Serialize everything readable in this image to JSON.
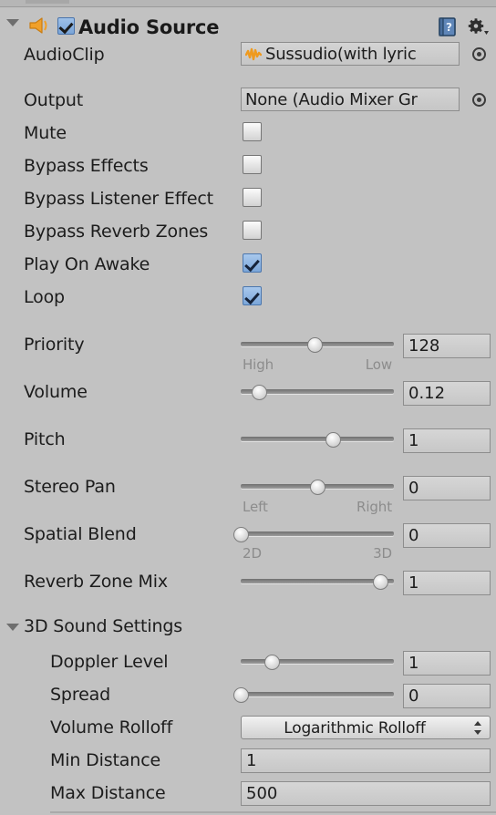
{
  "component": {
    "title": "Audio Source",
    "enabled_checkbox": true,
    "expanded": true,
    "icon": "speaker-icon",
    "help_icon": "help-book-icon",
    "menu_icon": "gear-icon"
  },
  "object_fields": [
    {
      "label": "AudioClip",
      "value": "Sussudio(with lyric",
      "icon": "audio-clip-icon",
      "has_picker": true
    },
    {
      "label": "Output",
      "value": "None (Audio Mixer Gr",
      "has_picker": true
    }
  ],
  "toggles": [
    {
      "label": "Mute",
      "checked": false
    },
    {
      "label": "Bypass Effects",
      "checked": false
    },
    {
      "label": "Bypass Listener Effect",
      "checked": false
    },
    {
      "label": "Bypass Reverb Zones",
      "checked": false
    },
    {
      "label": "Play On Awake",
      "checked": true
    },
    {
      "label": "Loop",
      "checked": true
    }
  ],
  "sliders": [
    {
      "label": "Priority",
      "value": "128",
      "fraction": 0.48,
      "min_label": "High",
      "max_label": "Low"
    },
    {
      "label": "Volume",
      "value": "0.12",
      "fraction": 0.12,
      "min_label": "",
      "max_label": ""
    },
    {
      "label": "Pitch",
      "value": "1",
      "fraction": 0.6,
      "min_label": "",
      "max_label": ""
    },
    {
      "label": "Stereo Pan",
      "value": "0",
      "fraction": 0.5,
      "min_label": "Left",
      "max_label": "Right"
    },
    {
      "label": "Spatial Blend",
      "value": "0",
      "fraction": 0.0,
      "min_label": "2D",
      "max_label": "3D"
    },
    {
      "label": "Reverb Zone Mix",
      "value": "1",
      "fraction": 0.91,
      "min_label": "",
      "max_label": ""
    }
  ],
  "sound_3d": {
    "section_title": "3D Sound Settings",
    "expanded": true,
    "sliders": [
      {
        "label": "Doppler Level",
        "value": "1",
        "fraction": 0.2
      },
      {
        "label": "Spread",
        "value": "0",
        "fraction": 0.0
      }
    ],
    "rolloff": {
      "label": "Volume Rolloff",
      "value": "Logarithmic Rolloff"
    },
    "distances": [
      {
        "label": "Min Distance",
        "value": "1"
      },
      {
        "label": "Max Distance",
        "value": "500"
      }
    ]
  },
  "colors": {
    "panel_bg": "#c2c2c2",
    "accent_checkbox": "#7ba6d9",
    "speaker_icon": "#f0a02a",
    "text": "#1c1c1c",
    "muted_text": "#8c8c8c"
  }
}
